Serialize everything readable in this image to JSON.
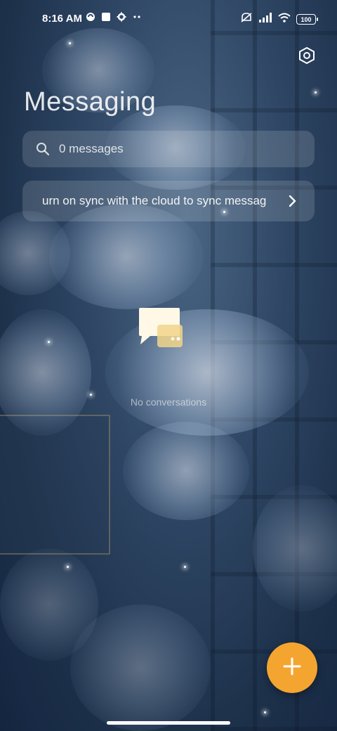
{
  "status_bar": {
    "time": "8:16 AM",
    "battery": "100",
    "left_icons": [
      "app-notification-icon",
      "square-notification-icon",
      "gear-notification-icon",
      "more-dots-icon"
    ],
    "right_icons": [
      "mute-icon",
      "signal-icon",
      "wifi-icon",
      "battery-icon"
    ]
  },
  "header": {
    "title": "Messaging",
    "settings_icon": "settings-hex-icon"
  },
  "search": {
    "placeholder": "0 messages",
    "icon": "search-icon"
  },
  "sync_banner": {
    "text": "urn on sync with the cloud to sync messag",
    "icon": "chevron-right-icon"
  },
  "empty_state": {
    "icon": "chat-bubbles-icon",
    "text": "No conversations"
  },
  "fab": {
    "icon": "plus-icon",
    "color": "#f4a530"
  },
  "colors": {
    "accent": "#f4a530",
    "background": "#2e4664"
  }
}
